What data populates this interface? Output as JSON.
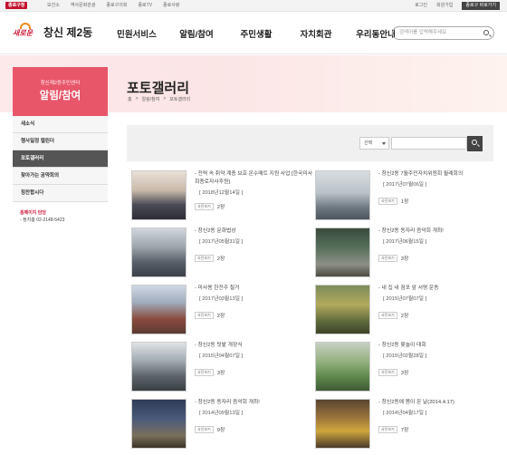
{
  "topbar": {
    "logo": "종로구청",
    "links": [
      "보건소",
      "역사문화관광",
      "종로구의회",
      "종로TV",
      "종로사랑"
    ],
    "right_links": [
      "로그인",
      "회원가입"
    ],
    "lang": "종로구 바로가기"
  },
  "header": {
    "brand_mark": "새로운",
    "brand_name": "창신 제2동",
    "nav": [
      "민원서비스",
      "알림/참여",
      "주민생활",
      "자치회관",
      "우리동안내"
    ],
    "search_placeholder": "검색어를 입력해주세요"
  },
  "sidebar": {
    "sub": "창신제2동주민센터",
    "title": "알림/참여",
    "items": [
      "새소식",
      "행사일정 캘린더",
      "포토갤러리",
      "찾아가는 공약회의",
      "칭찬합시다"
    ],
    "active_index": 2,
    "contact_title": "홈페이지 담당",
    "contact_phone": "- 정지홍 02-2148-5423"
  },
  "page": {
    "title": "포토갤러리",
    "breadcrumb": [
      "홈",
      ">",
      "알림/참여",
      ">",
      "포토갤러리"
    ]
  },
  "search": {
    "select_label": "선택"
  },
  "gallery": [
    {
      "title": "- 전력 속 취약 계층 보호 온수매트 지원 사업 [한국미사회종로자사후원]",
      "date": "[ 2018년12월14일 ]",
      "badge": "사진보기",
      "count": "2장"
    },
    {
      "title": "- 창신2동 7월주민자치위원회 월례회의",
      "date": "[ 2017년07월06일 ]",
      "badge": "사진보기",
      "count": "1장"
    },
    {
      "title": "- 창신2동 문화법상",
      "date": "[ 2017년05월31일 ]",
      "badge": "사진보기",
      "count": "2장"
    },
    {
      "title": "- 창신2동 동자리 음악회 개최!",
      "date": "[ 2017년06월15일 ]",
      "badge": "사진보기",
      "count": "3장"
    },
    {
      "title": "- 미사용 한전주 철거",
      "date": "[ 2017년03월13일 ]",
      "badge": "사진보기",
      "count": "2장"
    },
    {
      "title": "- 내 집 내 점포 앞 서명 운동",
      "date": "[ 2015년07월07일 ]",
      "badge": "사진보기",
      "count": "2장"
    },
    {
      "title": "- 창신2동 텃밭 개장식",
      "date": "[ 2015년04월07일 ]",
      "badge": "사진보기",
      "count": "3장"
    },
    {
      "title": "- 창신2동 윷놀이 대회",
      "date": "[ 2015년02월28일 ]",
      "badge": "사진보기",
      "count": "3장"
    },
    {
      "title": "- 창신2동 동자리 음악회 개최!",
      "date": "[ 2014년09월13일 ]",
      "badge": "사진보기",
      "count": "9장"
    },
    {
      "title": "- 창신2동에 봄이 온 날(2014.4.17)",
      "date": "[ 2014년04월17일 ]",
      "badge": "사진보기",
      "count": "7장"
    }
  ]
}
